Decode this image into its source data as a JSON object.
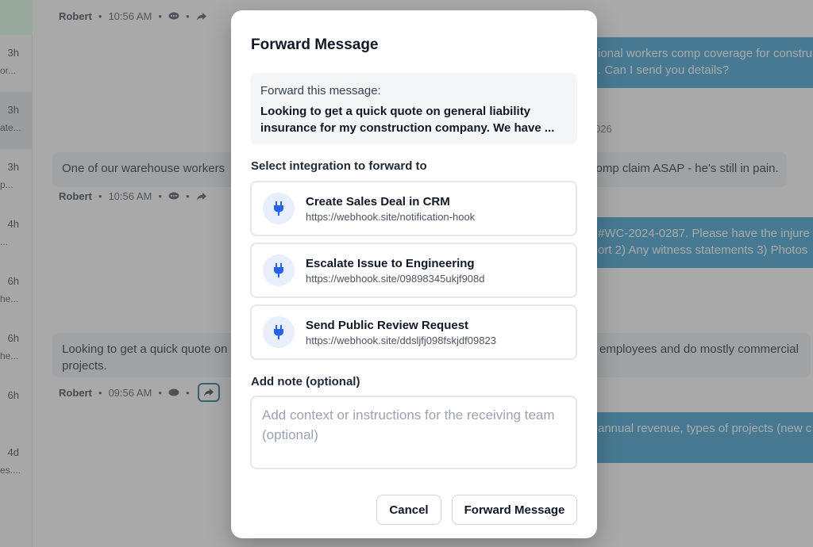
{
  "conversation_list": {
    "items": [
      {
        "time": "3h",
        "snippet": "or..."
      },
      {
        "time": "3h",
        "snippet": "ate..."
      },
      {
        "time": "3h",
        "snippet": "p..."
      },
      {
        "time": "4h",
        "snippet": "..."
      },
      {
        "time": "6h",
        "snippet": "he..."
      },
      {
        "time": "6h",
        "snippet": "he..."
      },
      {
        "time": "6h",
        "snippet": ""
      },
      {
        "time": "4d",
        "snippet": "es...."
      }
    ]
  },
  "feed": {
    "messages": [
      {
        "author": "Robert",
        "time": "10:56 AM"
      },
      {
        "text": "One of our warehouse workers",
        "text_right": "comp claim ASAP - he's still in pain.",
        "author": "Robert",
        "time": "10:56 AM"
      },
      {
        "text": "Looking to get a quick quote on",
        "text_right": "employees and do mostly commercial",
        "text_line2": "projects.",
        "author": "Robert",
        "time": "09:56 AM"
      }
    ],
    "outgoing": [
      {
        "line1": "ional workers comp coverage for constru",
        "line2": ". Can I send you details?"
      },
      {
        "line1": "#WC-2024-0287. Please have the injure",
        "line2": "ort 2) Any witness statements 3) Photos"
      },
      {
        "line1": "annual revenue, types of projects (new c",
        "line2": ""
      }
    ],
    "datestamp": "026"
  },
  "modal": {
    "title": "Forward Message",
    "quote_label": "Forward this message:",
    "quote_text": "Looking to get a quick quote on general liability insurance for my construction company. We have ...",
    "integration_label": "Select integration to forward to",
    "integrations": [
      {
        "name": "Create Sales Deal in CRM",
        "url": "https://webhook.site/notification-hook"
      },
      {
        "name": "Escalate Issue to Engineering",
        "url": "https://webhook.site/09898345ukjf908d"
      },
      {
        "name": "Send Public Review Request",
        "url": "https://webhook.site/ddsljfj098fskjdf09823"
      }
    ],
    "note_label": "Add note (optional)",
    "note_placeholder": "Add context or instructions for the receiving team (optional)",
    "note_value": "",
    "cancel_label": "Cancel",
    "forward_label": "Forward Message"
  },
  "colors": {
    "accent": "#3aa0d1",
    "plug_icon": "#2563eb",
    "forward_highlight": "#1f6f8b"
  }
}
